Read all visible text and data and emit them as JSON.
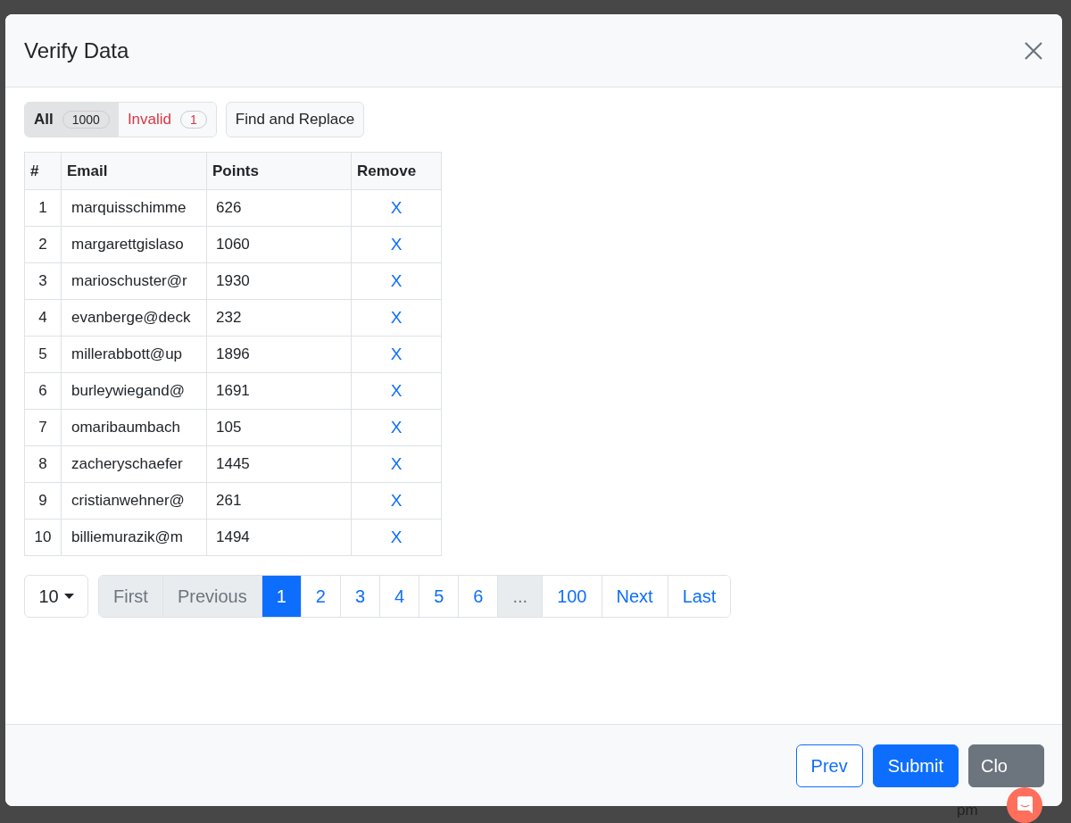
{
  "background": {
    "text": "pm"
  },
  "modal": {
    "title": "Verify Data",
    "filter_tabs": [
      {
        "label": "All",
        "count": "1000",
        "selected": true,
        "kind": "normal"
      },
      {
        "label": "Invalid",
        "count": "1",
        "selected": false,
        "kind": "danger"
      }
    ],
    "find_replace_button": "Find and Replace",
    "table": {
      "columns": [
        "#",
        "Email",
        "Points",
        "Remove"
      ],
      "rows": [
        {
          "index": "1",
          "email": "marquisschimme",
          "points": "626",
          "remove": "X"
        },
        {
          "index": "2",
          "email": "margarettgislaso",
          "points": "1060",
          "remove": "X"
        },
        {
          "index": "3",
          "email": "marioschuster@r",
          "points": "1930",
          "remove": "X"
        },
        {
          "index": "4",
          "email": "evanberge@deck",
          "points": "232",
          "remove": "X"
        },
        {
          "index": "5",
          "email": "millerabbott@up",
          "points": "1896",
          "remove": "X"
        },
        {
          "index": "6",
          "email": "burleywiegand@",
          "points": "1691",
          "remove": "X"
        },
        {
          "index": "7",
          "email": "omaribaumbach",
          "points": "105",
          "remove": "X"
        },
        {
          "index": "8",
          "email": "zacheryschaefer",
          "points": "1445",
          "remove": "X"
        },
        {
          "index": "9",
          "email": "cristianwehner@",
          "points": "261",
          "remove": "X"
        },
        {
          "index": "10",
          "email": "billiemurazik@m",
          "points": "1494",
          "remove": "X"
        }
      ]
    },
    "page_size": "10",
    "pagination": [
      {
        "label": "First",
        "selected": false,
        "disabled": true
      },
      {
        "label": "Previous",
        "selected": false,
        "disabled": true
      },
      {
        "label": "1",
        "selected": true,
        "disabled": false
      },
      {
        "label": "2",
        "selected": false,
        "disabled": false
      },
      {
        "label": "3",
        "selected": false,
        "disabled": false
      },
      {
        "label": "4",
        "selected": false,
        "disabled": false
      },
      {
        "label": "5",
        "selected": false,
        "disabled": false
      },
      {
        "label": "6",
        "selected": false,
        "disabled": false
      },
      {
        "label": "...",
        "selected": false,
        "disabled": true
      },
      {
        "label": "100",
        "selected": false,
        "disabled": false
      },
      {
        "label": "Next",
        "selected": false,
        "disabled": false
      },
      {
        "label": "Last",
        "selected": false,
        "disabled": false
      }
    ],
    "footer_buttons": [
      {
        "label": "Prev",
        "kind": "outline"
      },
      {
        "label": "Submit",
        "kind": "primary"
      },
      {
        "label": "Clo",
        "kind": "secondary"
      }
    ]
  }
}
